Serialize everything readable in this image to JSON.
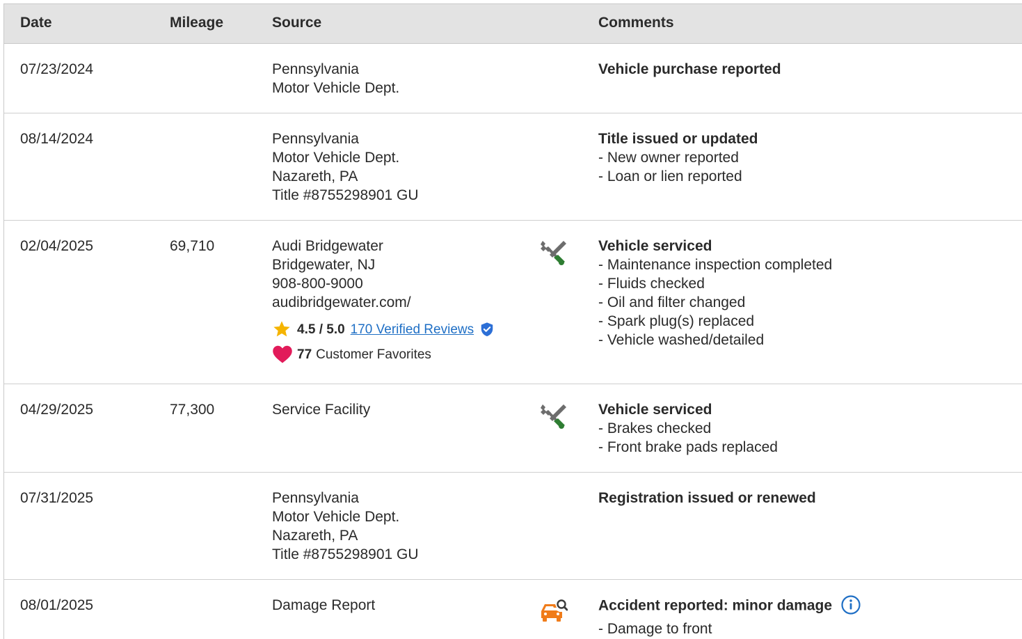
{
  "header": {
    "date": "Date",
    "mileage": "Mileage",
    "source": "Source",
    "comments": "Comments"
  },
  "rows": [
    {
      "date": "07/23/2024",
      "mileage": "",
      "source": [
        "Pennsylvania",
        "Motor Vehicle Dept."
      ],
      "icon": "",
      "comment_title": "Vehicle purchase reported",
      "bullets": []
    },
    {
      "date": "08/14/2024",
      "mileage": "",
      "source": [
        "Pennsylvania",
        "Motor Vehicle Dept.",
        "Nazareth, PA",
        "Title #8755298901 GU"
      ],
      "icon": "",
      "comment_title": "Title issued or updated",
      "bullets": [
        "- New owner reported",
        "- Loan or lien reported"
      ]
    },
    {
      "date": "02/04/2025",
      "mileage": "69,710",
      "source": [
        "Audi Bridgewater",
        "Bridgewater, NJ",
        "908-800-9000",
        "audibridgewater.com/"
      ],
      "rating": {
        "score": "4.5 / 5.0",
        "reviews_link": "170 Verified Reviews",
        "favorites_count": "77",
        "favorites_label": "Customer Favorites"
      },
      "icon": "wrench-screwdriver-icon",
      "comment_title": "Vehicle serviced",
      "bullets": [
        "- Maintenance inspection completed",
        "- Fluids checked",
        "- Oil and filter changed",
        "- Spark plug(s) replaced",
        "- Vehicle washed/detailed"
      ]
    },
    {
      "date": "04/29/2025",
      "mileage": "77,300",
      "source": [
        "Service Facility"
      ],
      "icon": "wrench-screwdriver-icon",
      "comment_title": "Vehicle serviced",
      "bullets": [
        "- Brakes checked",
        "- Front brake pads replaced"
      ]
    },
    {
      "date": "07/31/2025",
      "mileage": "",
      "source": [
        "Pennsylvania",
        "Motor Vehicle Dept.",
        "Nazareth, PA",
        "Title #8755298901 GU"
      ],
      "icon": "",
      "comment_title": "Registration issued or renewed",
      "bullets": []
    },
    {
      "date": "08/01/2025",
      "mileage": "",
      "source": [
        "Damage Report"
      ],
      "icon": "damaged-car-search-icon",
      "comment_title": "Accident reported: minor damage",
      "bullets": [
        "- Damage to front"
      ]
    }
  ],
  "colors": {
    "header_bg": "#e3e3e3",
    "link": "#1f6fc5",
    "star": "#f5b400",
    "heart": "#e21b5a",
    "wrench": "#6d6d6d",
    "screwdriver": "#2e7d32",
    "damage_icon": "#f07c1a"
  }
}
